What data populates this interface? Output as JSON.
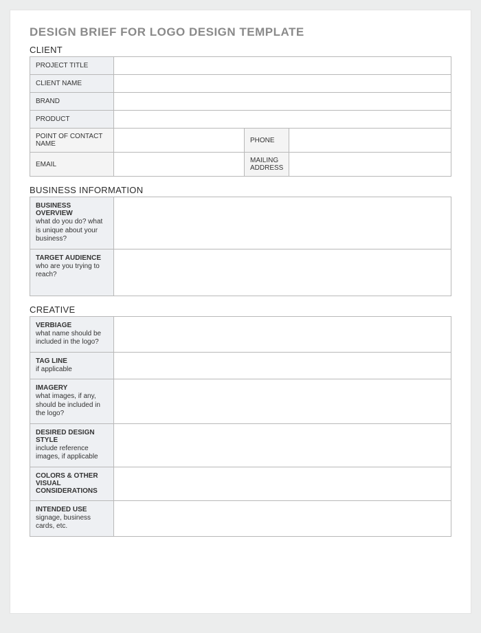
{
  "title": "DESIGN BRIEF FOR LOGO DESIGN TEMPLATE",
  "sections": {
    "client": {
      "header": "CLIENT",
      "project_title_label": "PROJECT TITLE",
      "project_title_value": "",
      "client_name_label": "CLIENT NAME",
      "client_name_value": "",
      "brand_label": "BRAND",
      "brand_value": "",
      "product_label": "PRODUCT",
      "product_value": "",
      "poc_label": "POINT OF CONTACT NAME",
      "poc_value": "",
      "phone_label": "PHONE",
      "phone_value": "",
      "email_label": "EMAIL",
      "email_value": "",
      "mailing_label": "MAILING ADDRESS",
      "mailing_value": ""
    },
    "business": {
      "header": "BUSINESS INFORMATION",
      "overview_label": "BUSINESS OVERVIEW",
      "overview_hint": "what do you do? what is unique about your business?",
      "overview_value": "",
      "audience_label": "TARGET AUDIENCE",
      "audience_hint": "who are you trying to reach?",
      "audience_value": ""
    },
    "creative": {
      "header": "CREATIVE",
      "verbiage_label": "VERBIAGE",
      "verbiage_hint": "what name should be included in the logo?",
      "verbiage_value": "",
      "tagline_label": "TAG LINE",
      "tagline_hint": "if applicable",
      "tagline_value": "",
      "imagery_label": "IMAGERY",
      "imagery_hint": "what images, if any, should be included in the logo?",
      "imagery_value": "",
      "style_label": "DESIRED DESIGN STYLE",
      "style_hint": "include reference images, if applicable",
      "style_value": "",
      "colors_label": "COLORS & OTHER VISUAL CONSIDERATIONS",
      "colors_hint": "",
      "colors_value": "",
      "use_label": "INTENDED USE",
      "use_hint": "signage, business cards, etc.",
      "use_value": ""
    }
  }
}
